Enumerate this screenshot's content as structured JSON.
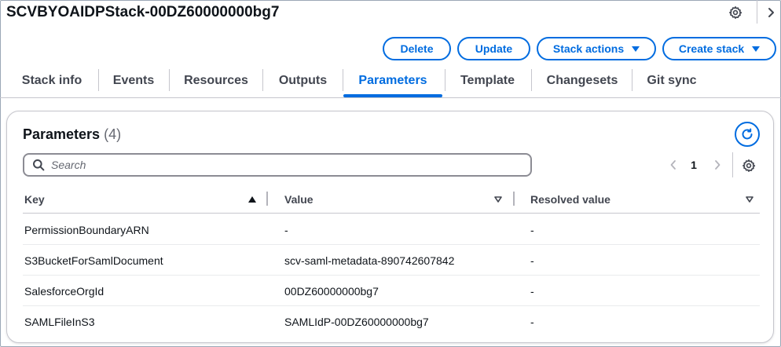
{
  "header": {
    "title": "SCVBYOAIDPStack-00DZ60000000bg7",
    "gear_icon": "gear-icon",
    "chevron_icon": "chevron-right-icon"
  },
  "actions": {
    "delete_label": "Delete",
    "update_label": "Update",
    "stack_actions_label": "Stack actions",
    "create_stack_label": "Create stack"
  },
  "tabs": [
    {
      "label": "Stack info"
    },
    {
      "label": "Events"
    },
    {
      "label": "Resources"
    },
    {
      "label": "Outputs"
    },
    {
      "label": "Parameters",
      "active": true
    },
    {
      "label": "Template"
    },
    {
      "label": "Changesets"
    },
    {
      "label": "Git sync"
    }
  ],
  "parameters": {
    "title": "Parameters",
    "count": "(4)",
    "search_placeholder": "Search",
    "page": "1",
    "columns": {
      "key": "Key",
      "value": "Value",
      "resolved": "Resolved value"
    },
    "rows": [
      {
        "key": "PermissionBoundaryARN",
        "value": "-",
        "resolved": "-"
      },
      {
        "key": "S3BucketForSamlDocument",
        "value": "scv-saml-metadata-890742607842",
        "resolved": "-"
      },
      {
        "key": "SalesforceOrgId",
        "value": "00DZ60000000bg7",
        "resolved": "-"
      },
      {
        "key": "SAMLFileInS3",
        "value": "SAMLIdP-00DZ60000000bg7",
        "resolved": "-"
      }
    ]
  },
  "colors": {
    "accent": "#006ce0",
    "text": "#0f141a",
    "muted": "#424650",
    "border": "#c6c6cd"
  }
}
